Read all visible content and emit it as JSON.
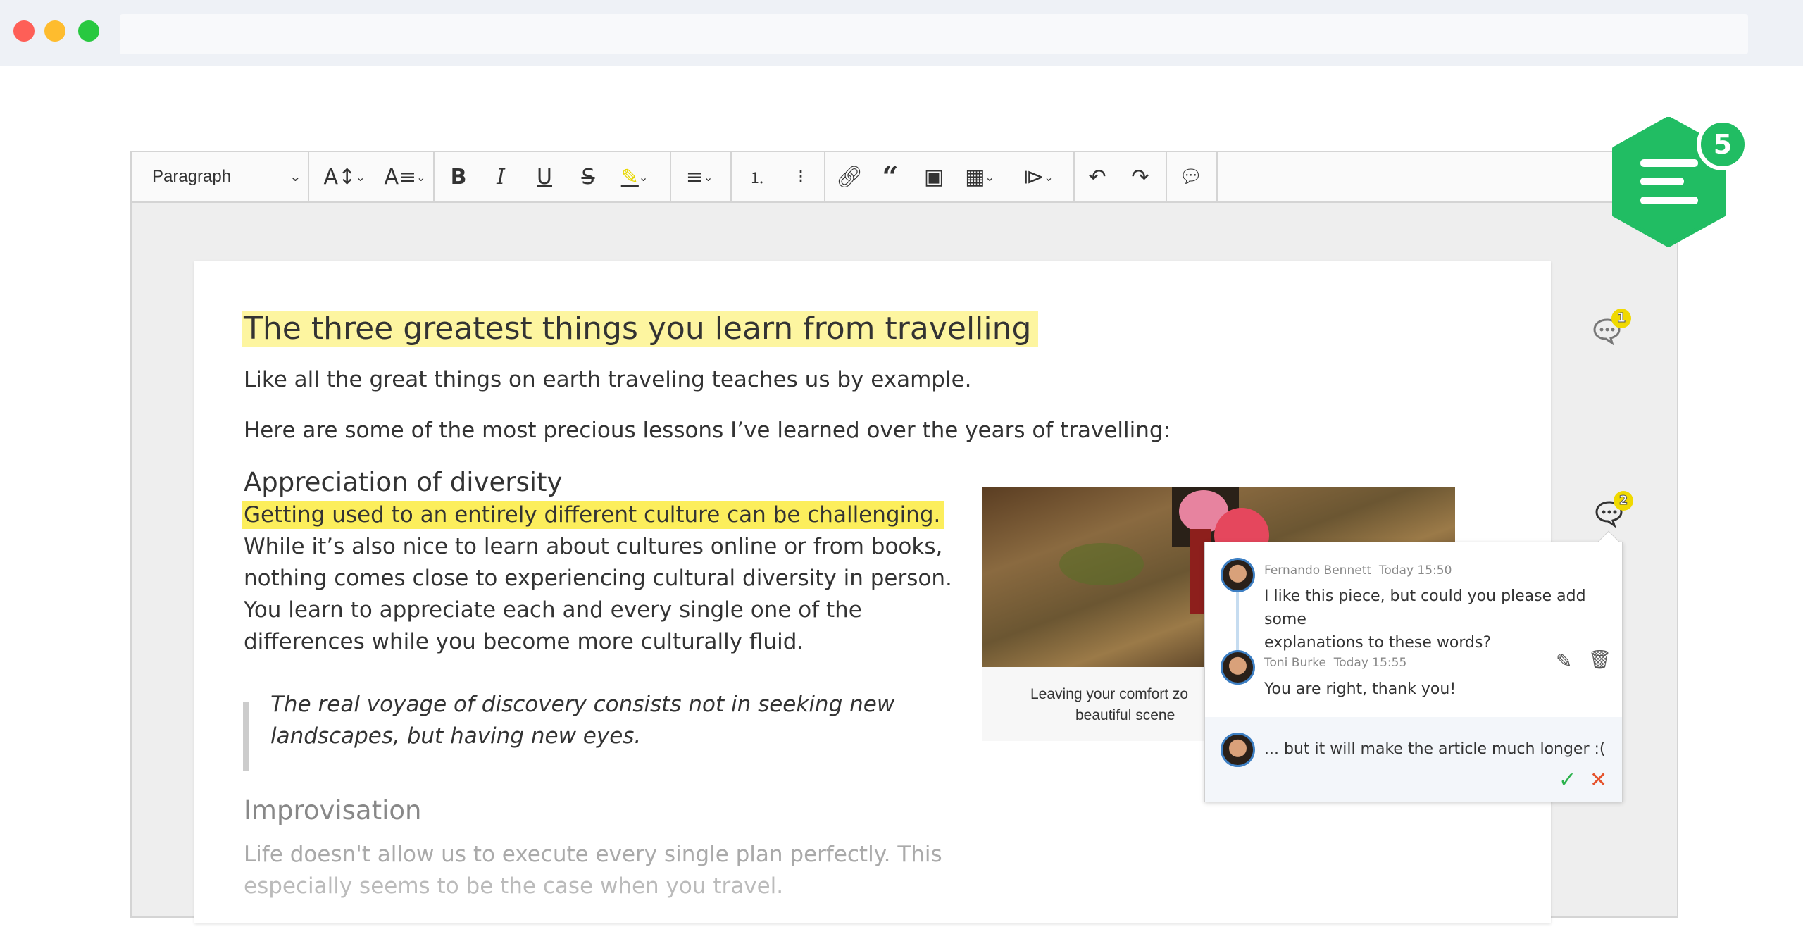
{
  "window": {
    "traffic_lights": [
      "#fe5f57",
      "#febc2e",
      "#28c840"
    ]
  },
  "toolbar": {
    "heading_select": "Paragraph",
    "icons": [
      "font-size-icon",
      "font-family-icon",
      "bold-icon",
      "italic-icon",
      "underline-icon",
      "strikethrough-icon",
      "highlight-icon",
      "alignment-icon",
      "numbered-list-icon",
      "bulleted-list-icon",
      "link-icon",
      "block-quote-icon",
      "insert-image-icon",
      "insert-table-icon",
      "insert-media-icon",
      "undo-icon",
      "redo-icon",
      "comment-icon"
    ]
  },
  "document": {
    "title": "The three greatest things you learn from travelling",
    "p1": "Like all the great things on earth traveling teaches us by example.",
    "p2": "Here are some of the most precious lessons I’ve learned over the years of travelling:",
    "h2_1": "Appreciation of diversity",
    "highlighted": "Getting used to an entirely different culture can be challenging.",
    "p3_lines": [
      "While it’s also nice to learn about cultures online or from books,",
      "nothing comes close to experiencing cultural diversity in person.",
      "You learn to appreciate each and every single one of the",
      "differences while you become more culturally fluid."
    ],
    "quote_lines": [
      "The real voyage of discovery consists not in seeking new",
      "landscapes, but having new eyes."
    ],
    "h2_2": "Improvisation",
    "p4_lines": [
      "Life doesn't allow us to execute every single plan perfectly. This",
      "especially seems to be the case when you travel."
    ],
    "caption_lines": [
      "Leaving your comfort zo",
      "beautiful scene"
    ],
    "highlight_colors": {
      "title": "#fdf5a0",
      "text": "#fcee5c"
    }
  },
  "comment_markers": [
    {
      "count": "1"
    },
    {
      "count": "2"
    }
  ],
  "comments_panel": {
    "thread": [
      {
        "author": "Fernando Bennett",
        "time": "Today 15:50",
        "text_lines": [
          "I like this piece, but could you please add some",
          "explanations to these words?"
        ]
      },
      {
        "author": "Toni Burke",
        "time": "Today 15:55",
        "text_lines": [
          "You are right, thank you!"
        ]
      }
    ],
    "reply_draft": "... but it will make the article much longer :(",
    "accent_confirm": "#2bb24c",
    "accent_cancel": "#e5522b"
  },
  "app_badge": {
    "count": "5",
    "color": "#21bd63"
  }
}
